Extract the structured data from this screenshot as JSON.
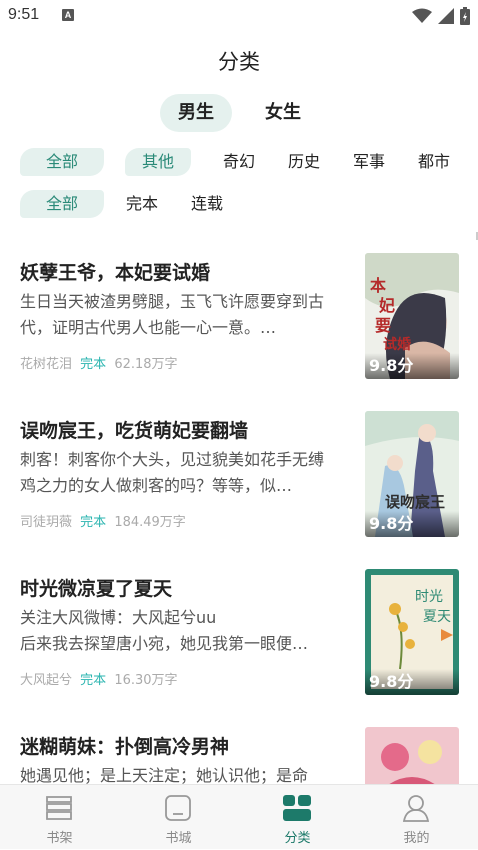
{
  "status_bar": {
    "time": "9:51",
    "notif_letter": "A"
  },
  "page_title": "分类",
  "gender_tabs": [
    {
      "label": "男生",
      "active": true
    },
    {
      "label": "女生",
      "active": false
    }
  ],
  "category_filters": [
    "全部",
    "其他",
    "奇幻",
    "历史",
    "军事",
    "都市"
  ],
  "status_filters": [
    "全部",
    "完本",
    "连载"
  ],
  "books": [
    {
      "title": "妖孽王爷，本妃要试婚",
      "desc": "生日当天被渣男劈腿，玉飞飞许愿要穿到古代，证明古代男人也能一心一意。…",
      "author": "花树花泪",
      "status": "完本",
      "words": "62.18万字",
      "score": "9.8分"
    },
    {
      "title": "误吻宸王，吃货萌妃要翻墙",
      "desc": "刺客！刺客你个大头，见过貌美如花手无缚鸡之力的女人做刺客的吗？等等，似…",
      "author": "司徒玥薇",
      "status": "完本",
      "words": "184.49万字",
      "score": "9.8分"
    },
    {
      "title": "时光微凉夏了夏天",
      "desc": "关注大风微博：大风起兮uu\n后来我去探望唐小宛，她见我第一眼便…",
      "author": "大风起兮",
      "status": "完本",
      "words": "16.30万字",
      "score": "9.8分"
    },
    {
      "title": "迷糊萌妹：扑倒高冷男神",
      "desc": "她遇见他；是上天注定；她认识他；是命",
      "author": "",
      "status": "",
      "words": "",
      "score": ""
    }
  ],
  "bottom_nav": [
    {
      "label": "书架",
      "icon": "bookshelf-icon",
      "active": false
    },
    {
      "label": "书城",
      "icon": "bookstore-icon",
      "active": false
    },
    {
      "label": "分类",
      "icon": "category-grid-icon",
      "active": true
    },
    {
      "label": "我的",
      "icon": "profile-icon",
      "active": false
    }
  ],
  "colors": {
    "accent": "#1d7a6a",
    "chip_bg": "#e5f1ee",
    "status_teal": "#2bb5b0"
  }
}
